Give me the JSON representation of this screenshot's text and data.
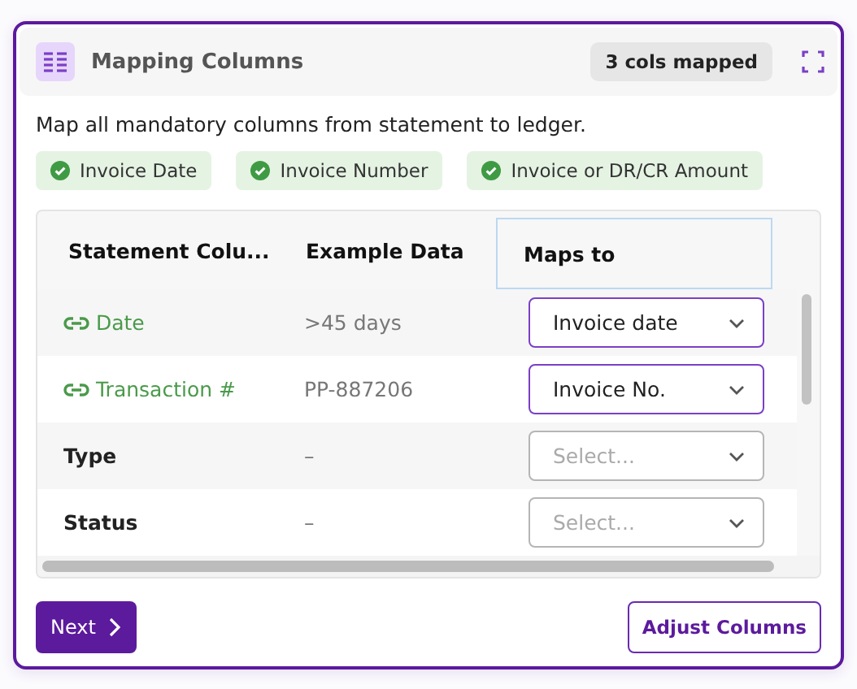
{
  "header": {
    "title": "Mapping Columns",
    "badge": "3 cols mapped"
  },
  "description": "Map all mandatory columns from statement to ledger.",
  "chips": [
    {
      "label": "Invoice Date",
      "done": true
    },
    {
      "label": "Invoice Number",
      "done": true
    },
    {
      "label": "Invoice or DR/CR Amount",
      "done": true
    }
  ],
  "table": {
    "columns": [
      {
        "label": "Statement Colu...",
        "focused": false
      },
      {
        "label": "Example Data",
        "focused": false
      },
      {
        "label": "Maps to",
        "focused": true
      }
    ],
    "rows": [
      {
        "kind": "linked",
        "name": "Date",
        "example": ">45 days",
        "select": {
          "value": "Invoice date"
        }
      },
      {
        "kind": "linked",
        "name": "Transaction #",
        "example": "PP-887206",
        "select": {
          "value": "Invoice No."
        }
      },
      {
        "kind": "plain",
        "name": "Type",
        "example": "–",
        "select": {
          "placeholder": "Select..."
        }
      },
      {
        "kind": "plain",
        "name": "Status",
        "example": "–",
        "select": {
          "placeholder": "Select..."
        }
      }
    ]
  },
  "buttons": {
    "next": "Next",
    "adjust": "Adjust Columns"
  }
}
